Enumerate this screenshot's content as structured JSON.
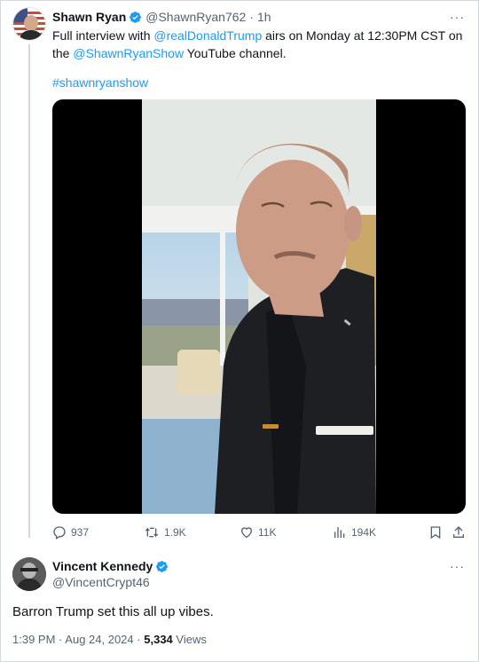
{
  "tweet": {
    "author_name": "Shawn Ryan",
    "handle": "@ShawnRyan762",
    "separator": "·",
    "time": "1h",
    "text_before_mention1": "Full interview with ",
    "mention1": "@realDonaldTrump",
    "text_middle": " airs on Monday at 12:30PM CST on the ",
    "mention2": "@ShawnRyanShow",
    "text_after": " YouTube channel.",
    "hashtag": "#shawnryanshow",
    "more": "···",
    "stats": {
      "replies": "937",
      "reposts": "1.9K",
      "likes": "11K",
      "views": "194K"
    }
  },
  "reply": {
    "author_name": "Vincent Kennedy",
    "handle": "@VincentCrypt46",
    "more": "···",
    "text": "Barron Trump set this all up vibes.",
    "time": "1:39 PM",
    "dot": "·",
    "date": "Aug 24, 2024",
    "views_count": "5,334",
    "views_label": "Views"
  },
  "colors": {
    "accent": "#1d9bf0",
    "text": "#0f1419",
    "muted": "#536471",
    "border": "#cfd9de"
  },
  "icons": [
    "verified-badge-icon",
    "reply-icon",
    "repost-icon",
    "like-icon",
    "views-icon",
    "bookmark-icon",
    "share-icon",
    "more-icon"
  ]
}
